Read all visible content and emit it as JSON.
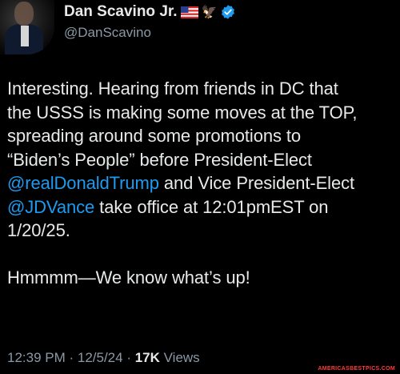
{
  "author": {
    "name": "Dan Scavino Jr.",
    "handle": "@DanScavino",
    "badges": [
      "us-flag-icon",
      "eagle-icon",
      "verified-badge-icon"
    ]
  },
  "tweet": {
    "line1": "Interesting. Hearing from friends in DC that",
    "line2": "the USSS is making some moves at the TOP,",
    "line3": "spreading around some promotions to",
    "line4": "“Biden’s People” before President-Elect",
    "mention1": "@realDonaldTrump",
    "line5_rest": " and Vice President-Elect",
    "mention2": "@JDVance",
    "line6_rest": " take office at 12:01pmEST on",
    "line7": "1/20/25.",
    "line8": "Hmmmm—We know what’s up!"
  },
  "meta": {
    "time": "12:39 PM",
    "sep1": " · ",
    "date": "12/5/24",
    "sep2": " · ",
    "views_count": "17K",
    "views_label": " Views"
  },
  "watermark": "AMERICASBESTPICS.COM",
  "colors": {
    "background": "#000000",
    "text": "#e7e9ea",
    "secondary": "#8b98a5",
    "link": "#1d9bf0"
  }
}
